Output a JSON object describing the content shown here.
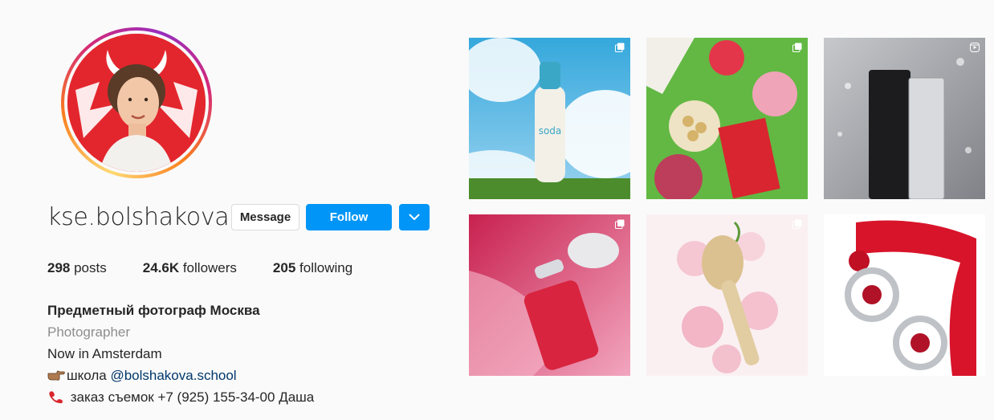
{
  "profile": {
    "username": "kse.bolshakova",
    "buttons": {
      "message": "Message",
      "follow": "Follow"
    },
    "stats": {
      "posts_count": "298",
      "posts_label": " posts",
      "followers_count": "24.6K",
      "followers_label": " followers",
      "following_count": "205",
      "following_label": " following"
    },
    "bio": {
      "name": "Предметный фотограф Москва",
      "category": "Photographer",
      "line1": "Now in Amsterdam",
      "school_prefix": "школа ",
      "school_link": "@bolshakova.school",
      "order_text": " заказ съемок +7 (925) 155-34-00 Даша"
    }
  },
  "posts": [
    {
      "id": "post-soda-foam",
      "icon": "carousel-icon"
    },
    {
      "id": "post-picnic",
      "icon": "carousel-icon"
    },
    {
      "id": "post-cleanser",
      "icon": "reel-icon"
    },
    {
      "id": "post-workout-jar",
      "icon": "carousel-icon"
    },
    {
      "id": "post-brush-roses",
      "icon": "carousel-icon"
    },
    {
      "id": "post-earrings",
      "icon": ""
    }
  ],
  "colors": {
    "accent": "#0095f6",
    "link": "#00376b",
    "muted": "#8e8e8e",
    "avatar_bg": "#e3262d"
  }
}
